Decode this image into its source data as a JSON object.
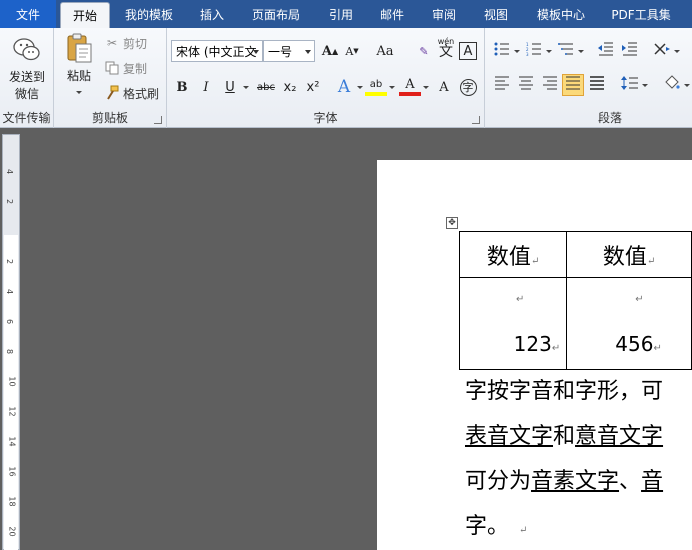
{
  "tabs": [
    {
      "label": "文件",
      "type": "file"
    },
    {
      "label": "开始",
      "type": "active"
    },
    {
      "label": "我的模板",
      "type": ""
    },
    {
      "label": "插入",
      "type": ""
    },
    {
      "label": "页面布局",
      "type": ""
    },
    {
      "label": "引用",
      "type": ""
    },
    {
      "label": "邮件",
      "type": ""
    },
    {
      "label": "审阅",
      "type": ""
    },
    {
      "label": "视图",
      "type": ""
    },
    {
      "label": "模板中心",
      "type": ""
    },
    {
      "label": "PDF工具集",
      "type": ""
    }
  ],
  "groups": {
    "file_transfer": {
      "label": "文件传输",
      "send_wechat_line1": "发送到",
      "send_wechat_line2": "微信"
    },
    "clipboard": {
      "label": "剪贴板",
      "paste": "粘贴",
      "cut": "剪切",
      "copy": "复制",
      "format_painter": "格式刷"
    },
    "font": {
      "label": "字体",
      "font_name": "宋体 (中文正文",
      "font_size": "一号",
      "grow": "A",
      "shrink": "A",
      "case": "Aa",
      "clear": "A",
      "phonetic_left": "wén",
      "phonetic_char": "文",
      "border_char": "A",
      "bold": "B",
      "italic": "I",
      "underline": "U",
      "strike": "abc",
      "subscript": "x₂",
      "superscript": "x²",
      "text_effect": "A",
      "highlight": "ab",
      "font_color": "A",
      "char_shading": "A",
      "enclose": "字"
    },
    "paragraph": {
      "label": "段落"
    }
  },
  "document": {
    "table": {
      "headers": [
        "数值",
        "数值"
      ],
      "values": [
        "123",
        "456"
      ]
    },
    "lines": [
      "字按字音和字形，可",
      "表音文字和意音文字",
      "可分为音素文字、音",
      "字。"
    ],
    "para_mark": "↵"
  },
  "ruler_numbers": [
    "4",
    "2",
    "",
    "2",
    "4",
    "6",
    "8",
    "10",
    "12",
    "14",
    "16",
    "18",
    "20"
  ]
}
